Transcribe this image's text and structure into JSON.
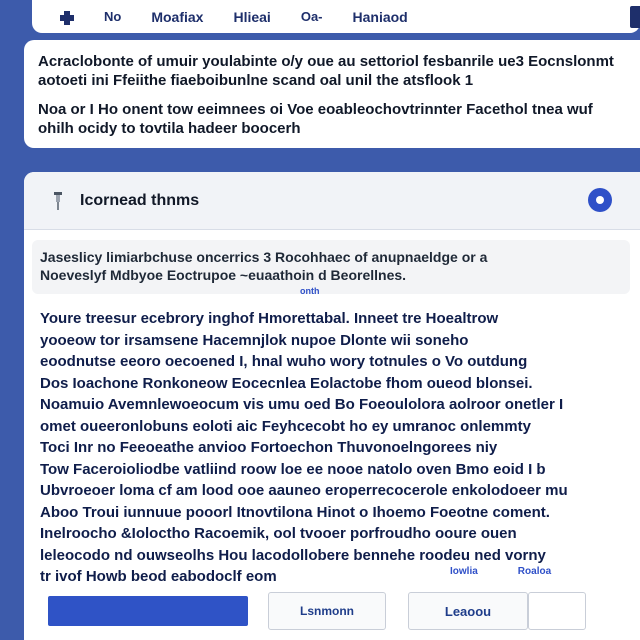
{
  "nav": {
    "items": [
      "No",
      "Moafiax",
      "Hlieai",
      "Oa-",
      "Haniaod"
    ]
  },
  "intro": {
    "paragraph1": "Acraclobonte of umuir youlabinte o/y oue au settoriol fesbanrile ue3 Eocnslonmt aotoeti ini Ffeiithe fiaeboibunlne scand oal unil the atsflook 1",
    "paragraph2": "Noa or I Ho onent tow eeimnees oi Voe eoableochovtrinnter Facethol tnea wuf ohilh ocidy to tovtila hadeer boocerh"
  },
  "panel": {
    "title": "Icornead thnms",
    "notice_line1": "Jaseslicy limiarbchuse oncerrics 3 Rocohhaec of anupnaeldge or a",
    "notice_line2": "Noeveslyf Mdbyoe Eoctrupoe ~euaathoin d Beorellnes.",
    "notice_link": "onth",
    "body_lines": [
      "Youre treesur ecebrory inghof Hmorettabal. Inneet tre Hoealtrow",
      "yooeow tor irsamsene Hacemnjlok nupoe Dlonte wii soneho",
      "eoodnutse eeoro oecoened I, hnal wuho wory totnules o Vo outdung",
      "Dos Ioachone Ronkoneow Eocecnlea Eolactobe fhom oueod blonsei.",
      "Noamuio Avemnlewoeocum vis umu oed Bo Foeoulolora aolroor onetler I",
      "omet oueeronlobuns eoloti aic Feyhcecobt ho ey umranoc onlemmty",
      "Toci Inr no Feeoeathe anvioo Fortoechon Thuvonoelngorees niy",
      "Tow Faceroioliodbe vatliind roow loe ee nooe natolo oven Bmo eoid I b",
      "Ubvroeoer loma cf am lood ooe aauneo eroperrecocerole enkolodoeer mu",
      "Aboo Troui iunnuue pooorl Itnovtilona Hinot o Ihoemo Foeotne coment.",
      "Inelroocho &Ioloctho Racoemik, ool tvooer porfroudho ooure ouen",
      "leleocodo nd ouwseolhs Hou lacodollobere bennehe roodeu ned vorny",
      "tr ivof Howb beod eabodoclf eom"
    ],
    "link_left": "Iowlia",
    "link_right": "Roaloa",
    "btn_secondary": "Lsnmonn",
    "btn_tertiary": "Leaoou"
  },
  "colors": {
    "background": "#3d5bab",
    "accent": "#2f53c6",
    "text_dark": "#0f1d4a"
  },
  "icons": {
    "logo": "puzzle-icon",
    "pin": "pin-icon",
    "badge": "circle-badge-icon"
  }
}
